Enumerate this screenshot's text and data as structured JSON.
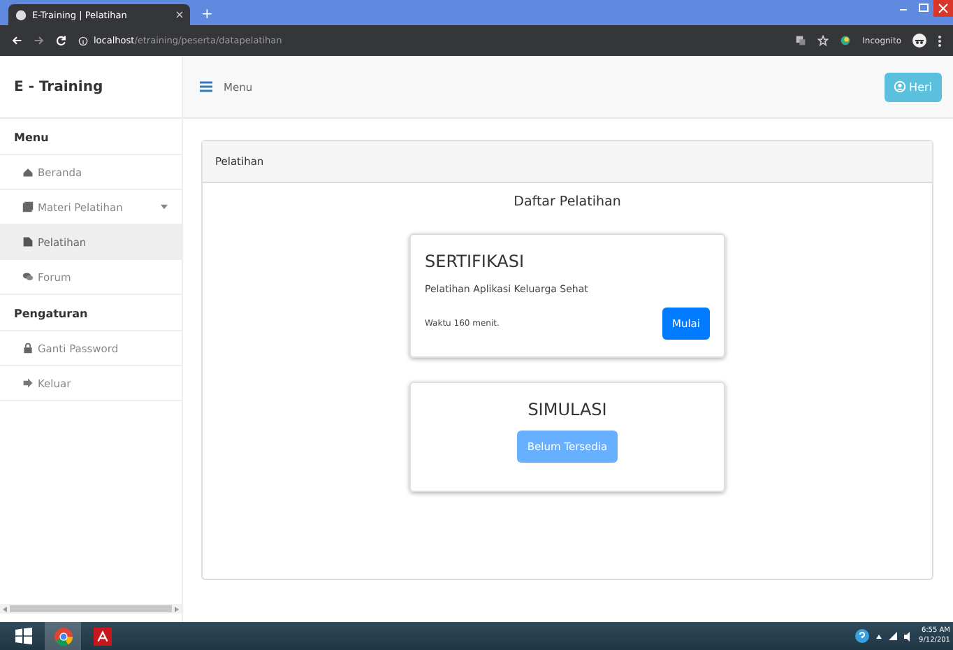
{
  "browser": {
    "tab_title": "E-Training | Pelatihan",
    "new_tab": "+",
    "url_host": "localhost",
    "url_path": "/etraining/peserta/datapelatihan",
    "incognito": "Incognito"
  },
  "sidebar": {
    "brand": "E - Training",
    "sections": [
      {
        "heading": "Menu",
        "items": [
          {
            "label": "Beranda",
            "selected": false
          },
          {
            "label": "Materi Pelatihan",
            "selected": false,
            "expanded": false
          },
          {
            "label": "Pelatihan",
            "selected": true
          },
          {
            "label": "Forum",
            "selected": false
          }
        ]
      },
      {
        "heading": "Pengaturan",
        "items": [
          {
            "label": "Ganti Password",
            "selected": false
          },
          {
            "label": "Keluar",
            "selected": false
          }
        ]
      }
    ]
  },
  "topbar": {
    "menu_label": "Menu",
    "user": "Heri"
  },
  "panel": {
    "heading": "Pelatihan",
    "title": "Daftar Pelatihan",
    "cards": [
      {
        "kind": "course",
        "title": "SERTIFIKASI",
        "subtitle": "Pelatihan Aplikasi Keluarga Sehat",
        "duration": "Waktu 160 menit.",
        "button": "Mulai",
        "disabled": false
      },
      {
        "kind": "unavailable",
        "title": "SIMULASI",
        "button": "Belum Tersedia",
        "disabled": true
      }
    ]
  },
  "taskbar": {
    "time": "6:55 AM",
    "date": "9/12/201"
  }
}
